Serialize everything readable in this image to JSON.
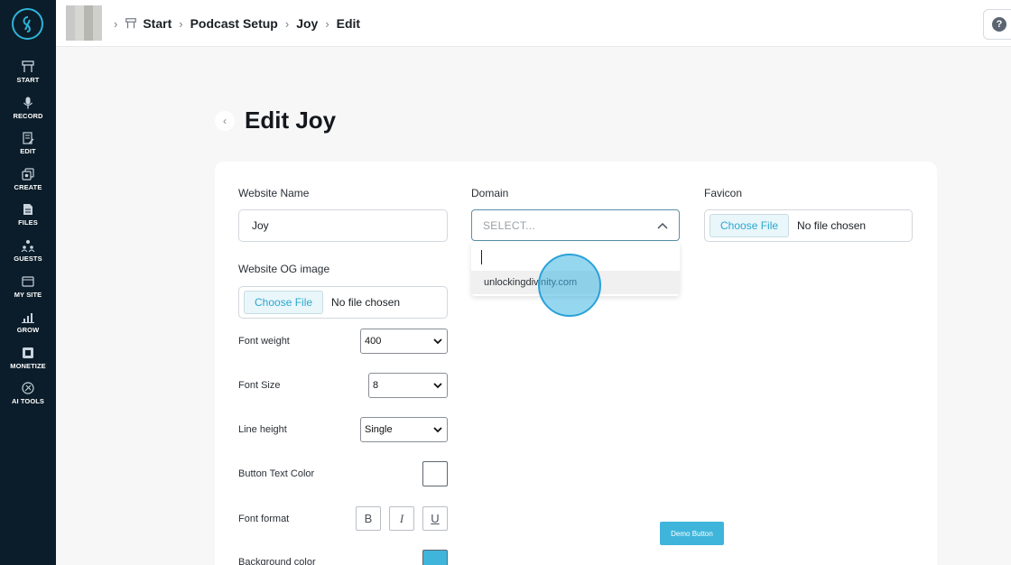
{
  "sidebar": {
    "items": [
      {
        "label": "START",
        "icon": "start-icon"
      },
      {
        "label": "RECORD",
        "icon": "microphone-icon"
      },
      {
        "label": "EDIT",
        "icon": "edit-icon"
      },
      {
        "label": "CREATE",
        "icon": "create-icon"
      },
      {
        "label": "FILES",
        "icon": "files-icon"
      },
      {
        "label": "GUESTS",
        "icon": "guests-icon"
      },
      {
        "label": "MY SITE",
        "icon": "my-site-icon"
      },
      {
        "label": "GROW",
        "icon": "grow-icon"
      },
      {
        "label": "MONETIZE",
        "icon": "monetize-icon"
      },
      {
        "label": "AI TOOLS",
        "icon": "ai-tools-icon"
      }
    ]
  },
  "header": {
    "breadcrumbs": [
      "Start",
      "Podcast Setup",
      "Joy",
      "Edit"
    ],
    "help": "?"
  },
  "page": {
    "title": "Edit Joy",
    "back": "‹"
  },
  "form": {
    "website_name_label": "Website Name",
    "website_name_value": "Joy",
    "domain_label": "Domain",
    "domain_placeholder": "SELECT...",
    "domain_option": "unlockingdivinity.com",
    "favicon_label": "Favicon",
    "og_image_label": "Website OG image",
    "choose_file": "Choose File",
    "no_file": "No file chosen",
    "font_weight_label": "Font weight",
    "font_weight_value": "400",
    "font_size_label": "Font Size",
    "font_size_value": "8",
    "line_height_label": "Line height",
    "line_height_value": "Single",
    "button_text_color_label": "Button Text Color",
    "button_text_color": "#ffffff",
    "font_format_label": "Font format",
    "format_bold": "B",
    "format_italic": "I",
    "format_underline": "U",
    "background_color_label": "Background color",
    "background_color": "#3fb5db",
    "demo_button": "Demo Button"
  },
  "colors": {
    "sidebar_bg": "#0b1d2a",
    "accent": "#2fb3d8"
  }
}
